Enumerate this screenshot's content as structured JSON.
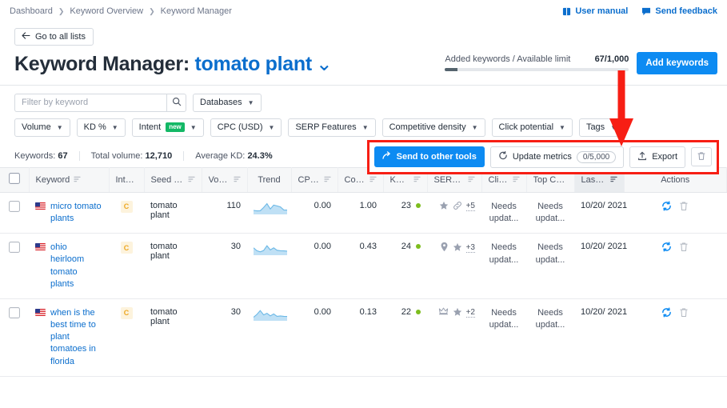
{
  "breadcrumb": [
    "Dashboard",
    "Keyword Overview",
    "Keyword Manager"
  ],
  "top_links": [
    {
      "label": "User manual",
      "icon": "book-icon"
    },
    {
      "label": "Send feedback",
      "icon": "speech-bubble-icon"
    }
  ],
  "back_button": "Go to all lists",
  "title": {
    "prefix": "Keyword Manager:",
    "name": "tomato plant",
    "caret": "⌄"
  },
  "limit": {
    "label": "Added keywords / Available limit",
    "count": "67/1,000",
    "percent": 6.7,
    "add_button": "Add keywords"
  },
  "search": {
    "placeholder": "Filter by keyword",
    "value": "",
    "icon": "search-icon"
  },
  "filters_row1": [
    {
      "label": "Databases"
    }
  ],
  "filters_row2": [
    {
      "label": "Volume"
    },
    {
      "label": "KD %"
    },
    {
      "label": "Intent",
      "badge": "new"
    },
    {
      "label": "CPC (USD)"
    },
    {
      "label": "SERP Features"
    },
    {
      "label": "Competitive density"
    },
    {
      "label": "Click potential"
    },
    {
      "label": "Tags"
    }
  ],
  "stats": [
    {
      "label": "Keywords:",
      "value": "67"
    },
    {
      "label": "Total volume:",
      "value": "12,710"
    },
    {
      "label": "Average KD:",
      "value": "24.3%"
    }
  ],
  "toolbar": {
    "send_to_other_tools": "Send to other tools",
    "update_metrics": "Update metrics",
    "update_metrics_count": "0/5,000",
    "export": "Export",
    "delete_icon": "trash-icon"
  },
  "columns": [
    {
      "key": "checkbox",
      "label": "",
      "sortable": false,
      "align": "center"
    },
    {
      "key": "keyword",
      "label": "Keyword",
      "sortable": true,
      "align": "left"
    },
    {
      "key": "intent",
      "label": "Intent",
      "sortable": false,
      "align": "center"
    },
    {
      "key": "seed_keyword",
      "label": "Seed Key...",
      "sortable": true,
      "align": "left"
    },
    {
      "key": "volume",
      "label": "Volume",
      "sortable": true,
      "align": "right"
    },
    {
      "key": "trend",
      "label": "Trend",
      "sortable": false,
      "align": "center"
    },
    {
      "key": "cpc",
      "label": "CPC ...",
      "sortable": true,
      "align": "right"
    },
    {
      "key": "com",
      "label": "Com.",
      "sortable": true,
      "align": "right"
    },
    {
      "key": "kd",
      "label": "KD %",
      "sortable": true,
      "align": "right"
    },
    {
      "key": "serp_features",
      "label": "SERP Fea...",
      "sortable": true,
      "align": "right"
    },
    {
      "key": "click_potential",
      "label": "Click...",
      "sortable": true,
      "align": "right"
    },
    {
      "key": "top_competitors",
      "label": "Top Co...",
      "sortable": false,
      "align": "center"
    },
    {
      "key": "last_change",
      "label": "Last Ch...",
      "sortable": true,
      "align": "right",
      "active": true
    },
    {
      "key": "actions",
      "label": "Actions",
      "sortable": false,
      "align": "center"
    }
  ],
  "rows": [
    {
      "checked": false,
      "flag": "us-flag-icon",
      "keyword": "micro tomato plants",
      "intent": "C",
      "seed_keyword": "tomato plant",
      "volume": "110",
      "trend": [
        0.25,
        0.2,
        0.22,
        0.55,
        0.95,
        0.4,
        0.8,
        0.72,
        0.62,
        0.3,
        0.28
      ],
      "cpc": "0.00",
      "com": "1.00",
      "kd": "23",
      "kd_dot_color": "#7dbd1e",
      "serp_icons": [
        "star-icon",
        "link-icon"
      ],
      "serp_more": "+5",
      "click_potential": "Needs updat...",
      "top_competitors": "Needs updat...",
      "last_change": "10/20/ 2021",
      "actions": [
        "refresh-icon",
        "trash-icon"
      ]
    },
    {
      "checked": false,
      "flag": "us-flag-icon",
      "keyword": "ohio heirloom tomato plants",
      "intent": "C",
      "seed_keyword": "tomato plant",
      "volume": "30",
      "trend": [
        0.6,
        0.3,
        0.18,
        0.32,
        0.82,
        0.38,
        0.6,
        0.35,
        0.3,
        0.28,
        0.26
      ],
      "cpc": "0.00",
      "com": "0.43",
      "kd": "24",
      "kd_dot_color": "#7dbd1e",
      "serp_icons": [
        "map-pin-icon",
        "star-icon"
      ],
      "serp_more": "+3",
      "click_potential": "Needs updat...",
      "top_competitors": "Needs updat...",
      "last_change": "10/20/ 2021",
      "actions": [
        "refresh-icon",
        "trash-icon"
      ]
    },
    {
      "checked": false,
      "flag": "us-flag-icon",
      "keyword": "when is the best time to plant tomatoes in florida",
      "intent": "C",
      "seed_keyword": "tomato plant",
      "volume": "30",
      "trend": [
        0.2,
        0.5,
        0.9,
        0.45,
        0.62,
        0.35,
        0.55,
        0.3,
        0.34,
        0.3,
        0.28
      ],
      "cpc": "0.00",
      "com": "0.13",
      "kd": "22",
      "kd_dot_color": "#7dbd1e",
      "serp_icons": [
        "crown-icon",
        "star-icon"
      ],
      "serp_more": "+2",
      "click_potential": "Needs updat...",
      "top_competitors": "Needs updat...",
      "last_change": "10/20/ 2021",
      "actions": [
        "refresh-icon",
        "trash-icon"
      ]
    }
  ],
  "annotation": {
    "arrow_color": "#f71e14",
    "highlight_color": "#f71e14"
  },
  "colors": {
    "link": "#0b6ecd",
    "primary_button": "#0d8bf2",
    "new_badge": "#14b866",
    "intent_commercial": "#eda723",
    "kd_green": "#7dbd1e"
  }
}
